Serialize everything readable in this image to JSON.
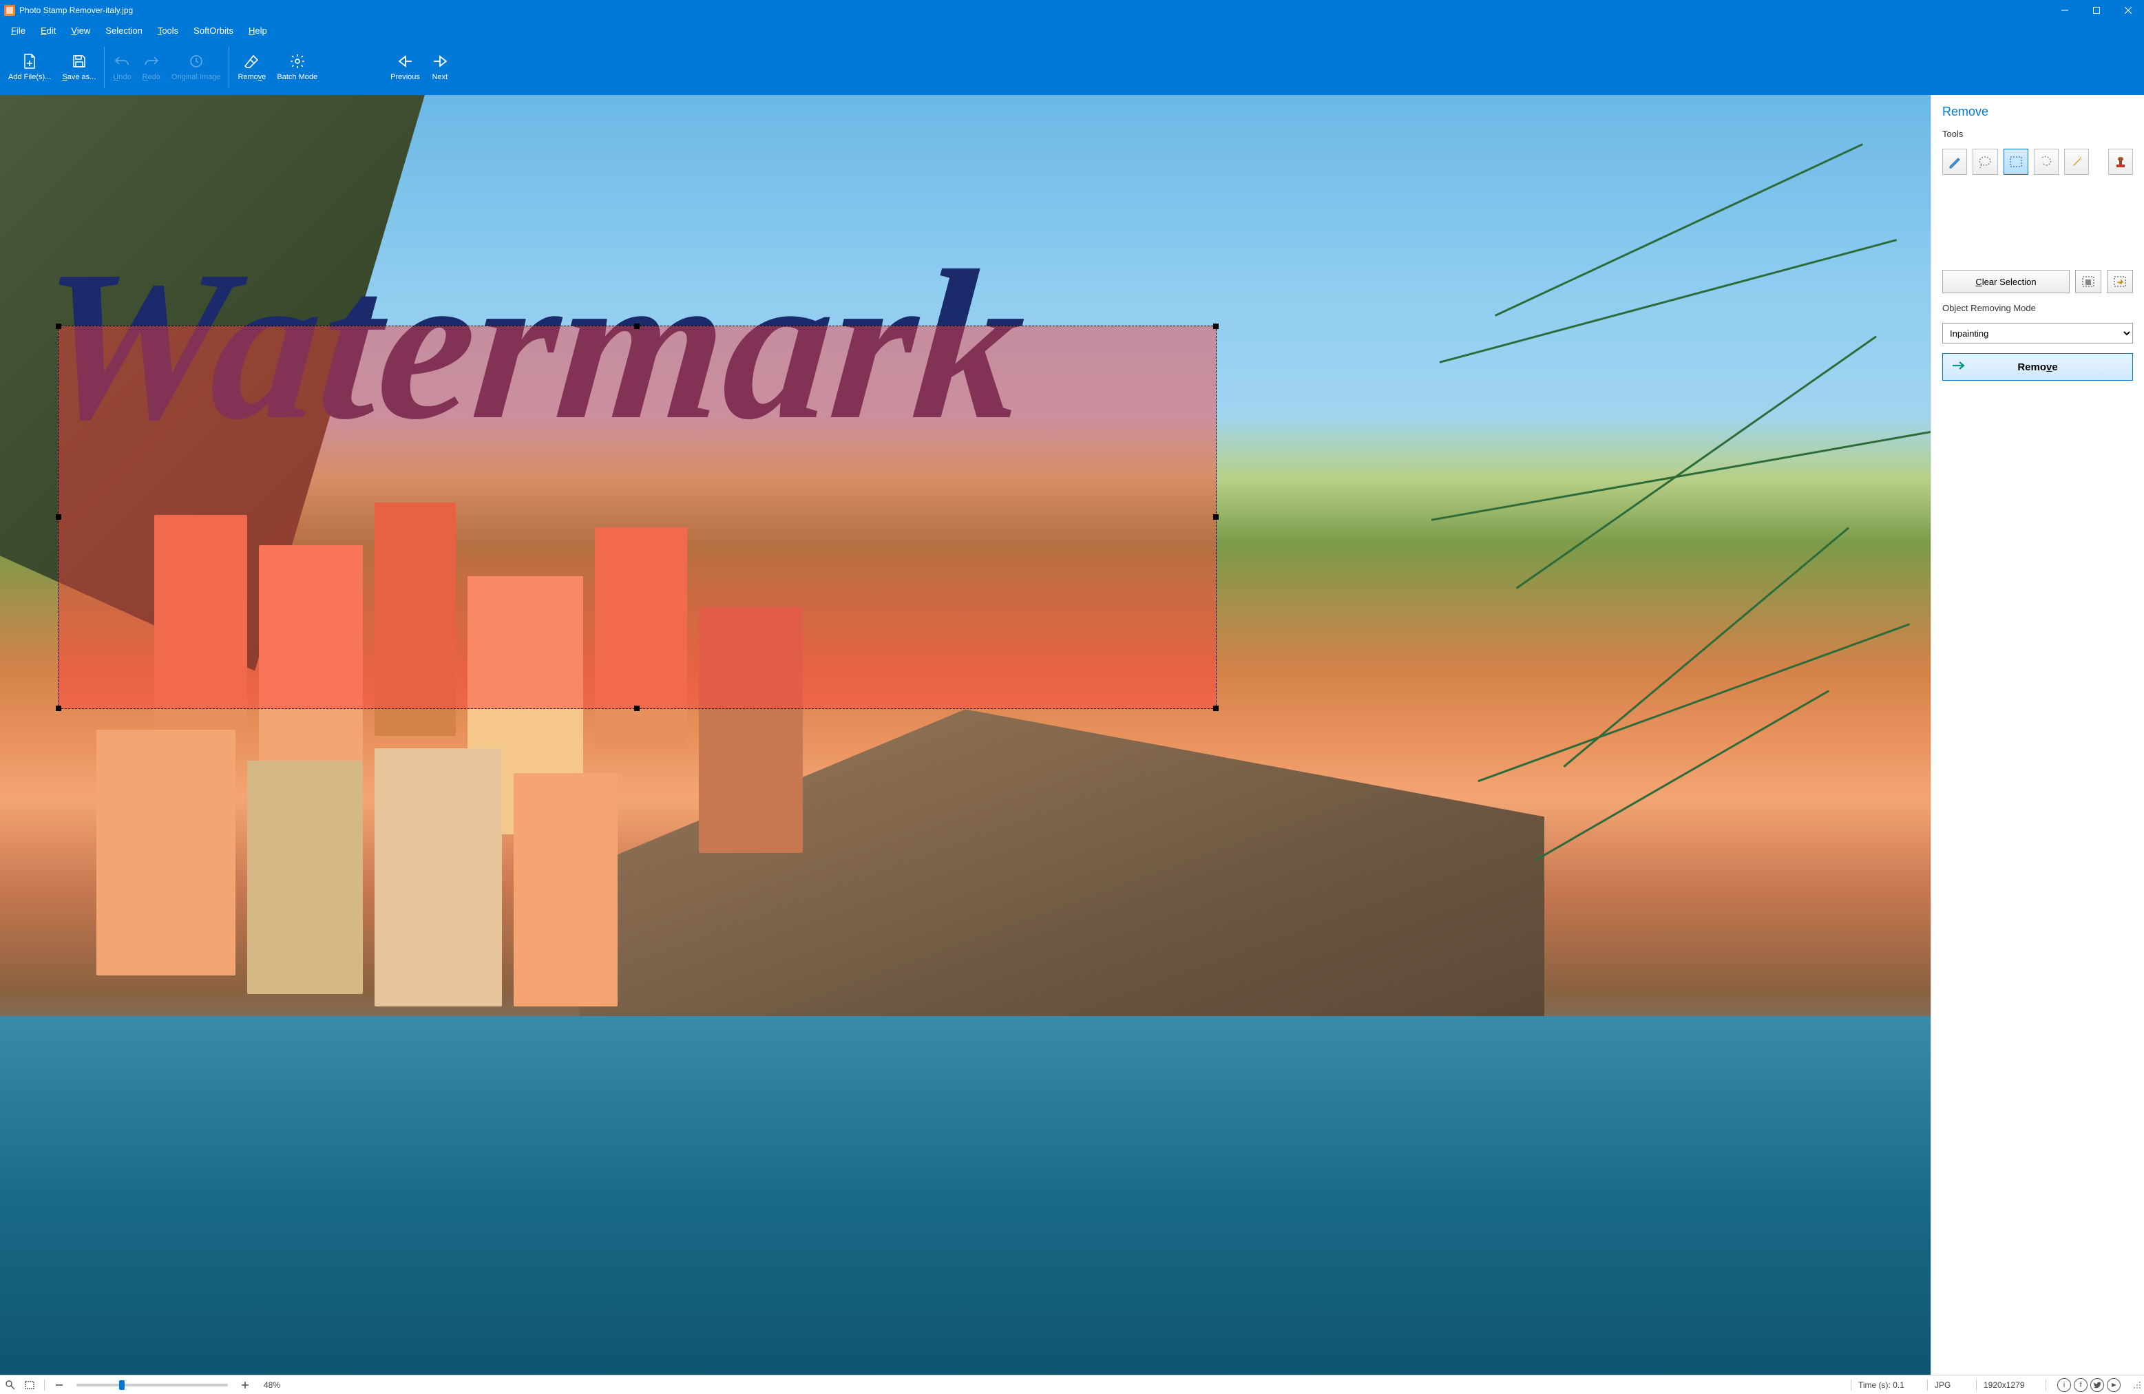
{
  "titlebar": {
    "app_name": "Photo Stamp Remover",
    "separator": " - ",
    "file_name": "italy.jpg"
  },
  "menubar": {
    "items": [
      "File",
      "Edit",
      "View",
      "Selection",
      "Tools",
      "SoftOrbits",
      "Help"
    ]
  },
  "toolbar": {
    "add_files": "Add File(s)...",
    "save_as": "Save as...",
    "undo": "Undo",
    "redo": "Redo",
    "original_image": "Original Image",
    "remove": "Remove",
    "batch_mode": "Batch Mode",
    "previous": "Previous",
    "next": "Next"
  },
  "canvas": {
    "watermark_text": "Watermark"
  },
  "rpanel": {
    "title": "Remove",
    "tools_label": "Tools",
    "clear_selection": "Clear Selection",
    "mode_label": "Object Removing Mode",
    "mode_value": "Inpainting",
    "remove_button": "Remove"
  },
  "statusbar": {
    "zoom_percent": "48%",
    "time_label": "Time (s): 0.1",
    "format": "JPG",
    "dimensions": "1920x1279"
  }
}
